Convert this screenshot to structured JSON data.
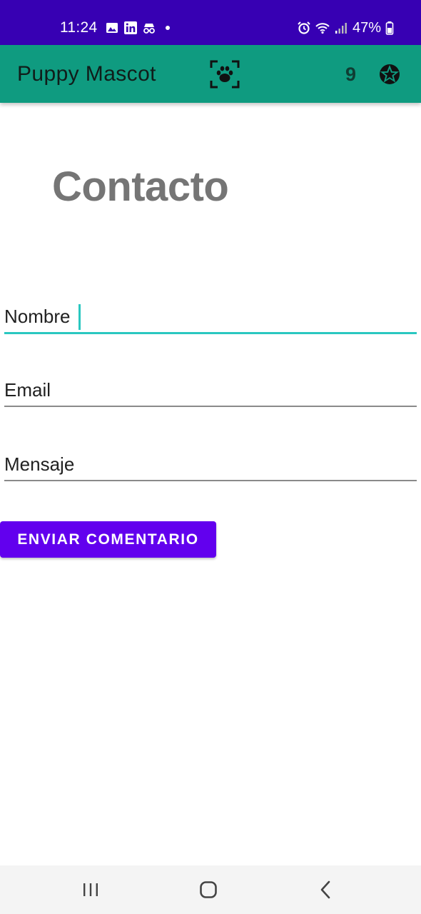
{
  "status_bar": {
    "time": "11:24",
    "battery": "47%",
    "left_icons": [
      "image-icon",
      "linkedin-icon",
      "incognito-icon",
      "dot-icon"
    ],
    "right_icons": [
      "alarm-icon",
      "wifi-icon",
      "signal-icon",
      "battery-icon"
    ]
  },
  "app_bar": {
    "title": "Puppy Mascot",
    "counter": "9",
    "background": "#0f9b80"
  },
  "page": {
    "title": "Contacto"
  },
  "form": {
    "name_placeholder": "Nombre",
    "email_placeholder": "Email",
    "message_placeholder": "Mensaje",
    "name_value": "",
    "email_value": "",
    "message_value": "",
    "submit_label": "ENVIAR COMENTARIO"
  },
  "colors": {
    "status_bar": "#3700b3",
    "accent_focus": "#2ac7c0",
    "button": "#6200ee"
  },
  "nav_bar": {
    "buttons": [
      "recents-icon",
      "home-icon",
      "back-icon"
    ]
  }
}
